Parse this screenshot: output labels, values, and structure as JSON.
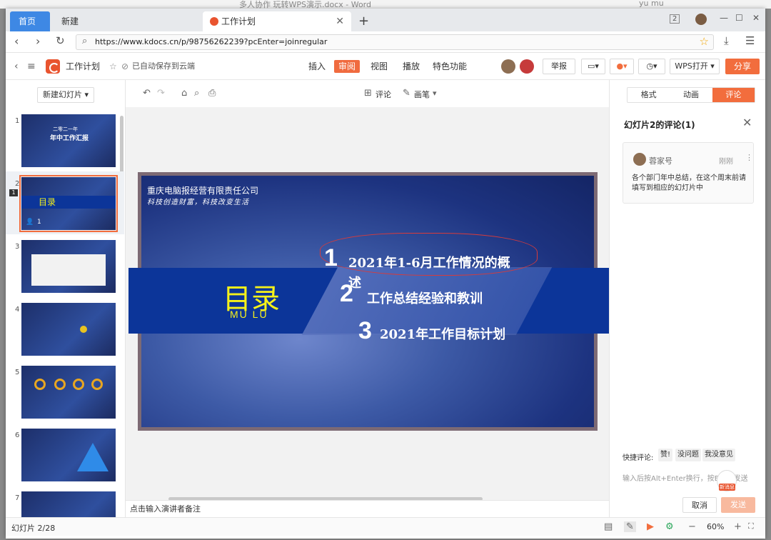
{
  "background_doc": {
    "title": "多人协作 玩转WPS演示.docx - Word",
    "user": "yu mu"
  },
  "tabs": {
    "home": "首页",
    "new": "新建",
    "active": "工作计划",
    "plus": "+"
  },
  "window_controls": {
    "badge": "2",
    "minimize": "—",
    "maximize": "☐",
    "close": "✕"
  },
  "address": {
    "url": "https://www.kdocs.cn/p/98756262239?pcEnter=joinregular"
  },
  "header": {
    "doc_name": "工作计划",
    "autosave": "已自动保存到云端",
    "menu": [
      "插入",
      "审阅",
      "视图",
      "播放",
      "特色功能"
    ],
    "report": "举报",
    "wps_open": "WPS打开",
    "share": "分享"
  },
  "left_panel": {
    "new_slide": "新建幻灯片",
    "slide_numbers": [
      "1",
      "2",
      "3",
      "4",
      "5",
      "6",
      "7"
    ],
    "comment_count": "1",
    "thumb1_title1": "二零二一年",
    "thumb1_title2": "年中工作汇报",
    "thumb2_title": "目录"
  },
  "toolbar": {
    "comment": "评论",
    "pen": "画笔"
  },
  "slide": {
    "company": "重庆电脑报经营有限责任公司",
    "slogan": "科技创造财富，科技改变生活",
    "title_cn": "目录",
    "title_en": "MU LU",
    "items": [
      {
        "num": "1",
        "text": "2021年1-6月工作情况的概",
        "wrap": "述"
      },
      {
        "num": "2",
        "text": "工作总结经验和教训"
      },
      {
        "num": "3",
        "text": "2021年工作目标计划"
      }
    ]
  },
  "notes": {
    "placeholder": "点击输入演讲者备注"
  },
  "right_panel": {
    "tabs": [
      "格式",
      "动画",
      "评论"
    ],
    "title": "幻灯片2的评论(1)",
    "comment": {
      "author": "蓉家号",
      "time": "刚刚",
      "body": "各个部门年中总结，在这个周末前请填写到相应的幻灯片中"
    },
    "quick_label": "快捷评论:",
    "quick": [
      "赞!",
      "没问题",
      "我没意见"
    ],
    "input_placeholder": "输入后按Alt+Enter换行，按Enter发送",
    "mascot": "新消息",
    "cancel": "取消",
    "send": "发送"
  },
  "status": {
    "slide_indicator": "幻灯片 2/28",
    "zoom": "60%"
  },
  "colors": {
    "accent": "#f26d3d",
    "home_tab": "#3e88e4",
    "slide_band": "#0c3599",
    "title_yellow": "#f5f11a"
  }
}
